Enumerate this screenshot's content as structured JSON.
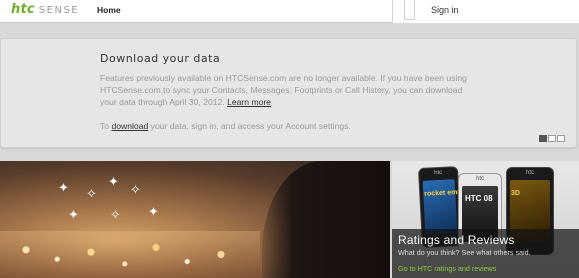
{
  "header": {
    "logo_brand": "htc",
    "logo_product": "SENSE",
    "nav_home": "Home",
    "sign_in": "Sign in"
  },
  "notice": {
    "title": "Download your data",
    "body": "Features previously available on HTCSense.com are no longer available. If you have been using HTCSense.com to sync your Contacts, Messages, Footprints or Call History, you can download your data through April 30, 2012.",
    "learn_more": "Learn more",
    "cta_prefix": "To",
    "cta_link": "download",
    "cta_suffix": "your data, sign in, and access your Account settings.",
    "pager": {
      "count": 3,
      "active_index": 0
    }
  },
  "promo": {
    "title": "Ratings and Reviews",
    "subtitle": "What do you think? See what others said.",
    "link": "Go to HTC ratings and reviews",
    "phone_brand": "htc",
    "phone1_text": "rocket empire",
    "phone2_text": "HTC 08",
    "phone3_text": "3D"
  },
  "colors": {
    "brand_green": "#6ab023",
    "link_green": "#8ecf3a"
  }
}
